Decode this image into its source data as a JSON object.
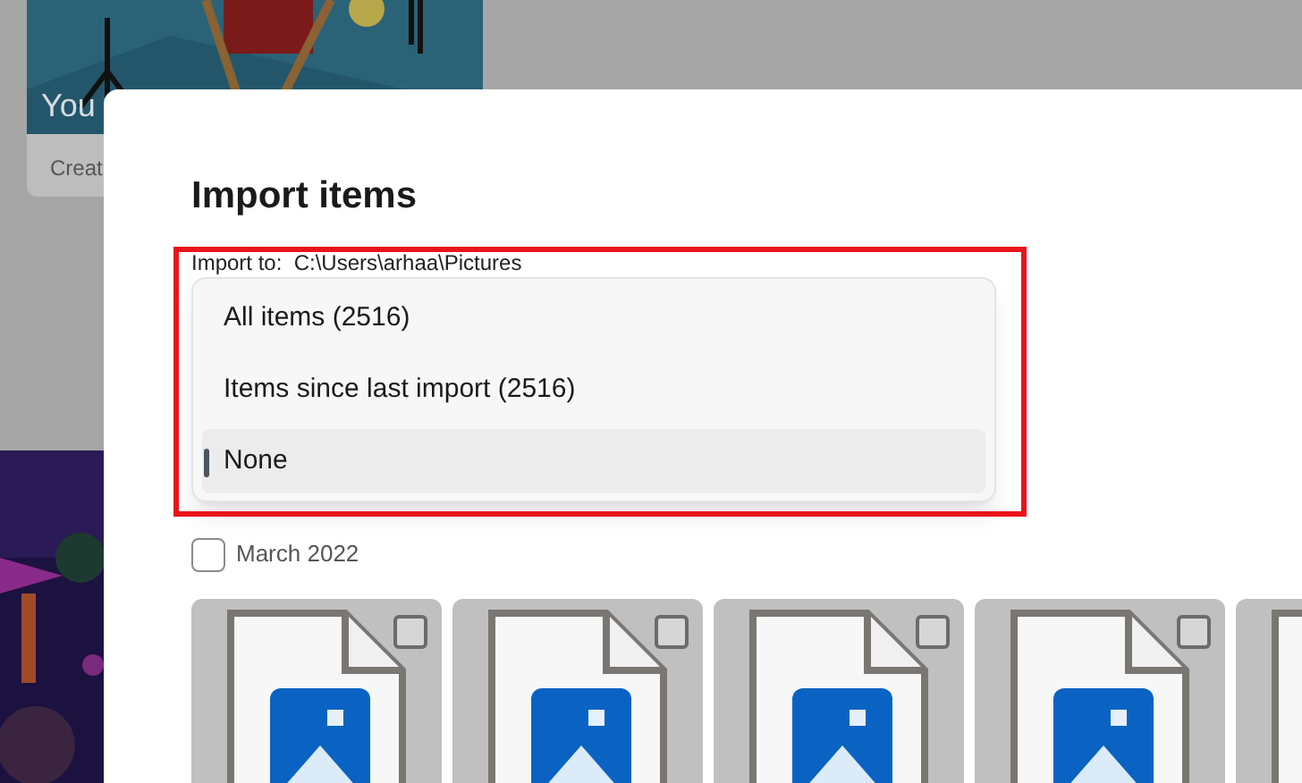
{
  "background": {
    "card": {
      "title": "You",
      "caption": "Creat"
    }
  },
  "dialog": {
    "title": "Import items",
    "import_to": "Import to:  C:\\Users\\arhaa\\Pictures",
    "menu": [
      {
        "label": "All items (2516)",
        "selected": false
      },
      {
        "label": "Items since last import (2516)",
        "selected": false
      },
      {
        "label": "None",
        "selected": true
      }
    ],
    "group": {
      "label": "March 2022",
      "checked": false
    },
    "items": [
      {
        "checked": false
      },
      {
        "checked": false
      },
      {
        "checked": false
      },
      {
        "checked": false
      }
    ]
  }
}
